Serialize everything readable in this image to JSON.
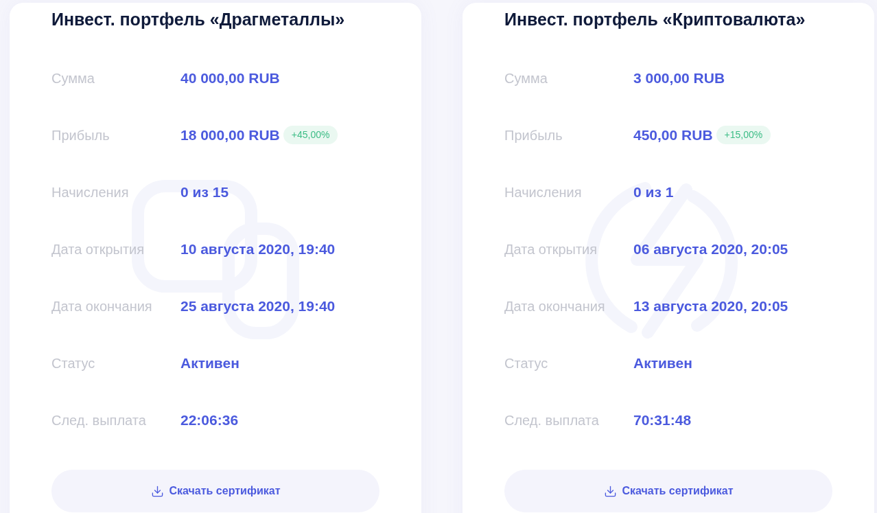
{
  "portfolios": [
    {
      "title": "Инвест. портфель «Драгметаллы»",
      "fields": [
        {
          "label": "Сумма",
          "value": "40 000,00 RUB"
        },
        {
          "label": "Прибыль",
          "value": "18 000,00 RUB",
          "badge": "+45,00%"
        },
        {
          "label": "Начисления",
          "value": "0 из 15"
        },
        {
          "label": "Дата открытия",
          "value": "10 августа 2020, 19:40"
        },
        {
          "label": "Дата окончания",
          "value": "25 августа 2020, 19:40"
        },
        {
          "label": "Статус",
          "value": "Активен"
        },
        {
          "label": "След. выплата",
          "value": "22:06:36"
        }
      ],
      "button": "Скачать сертификат"
    },
    {
      "title": "Инвест. портфель «Криптовалюта»",
      "fields": [
        {
          "label": "Сумма",
          "value": "3 000,00 RUB"
        },
        {
          "label": "Прибыль",
          "value": "450,00 RUB",
          "badge": "+15,00%"
        },
        {
          "label": "Начисления",
          "value": "0 из 1"
        },
        {
          "label": "Дата открытия",
          "value": "06 августа 2020, 20:05"
        },
        {
          "label": "Дата окончания",
          "value": "13 августа 2020, 20:05"
        },
        {
          "label": "Статус",
          "value": "Активен"
        },
        {
          "label": "След. выплата",
          "value": "70:31:48"
        }
      ],
      "button": "Скачать сертификат"
    }
  ]
}
